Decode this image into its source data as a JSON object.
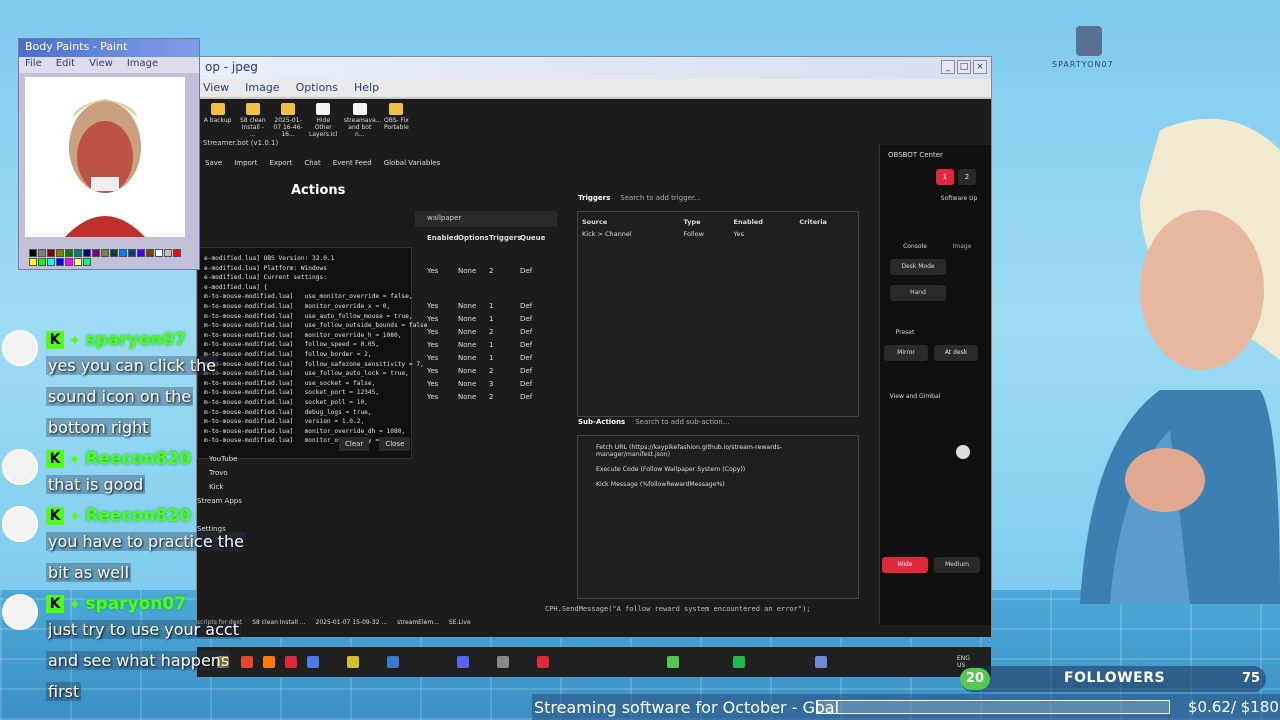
{
  "main_window": {
    "title": "op - jpeg",
    "menu": [
      "View",
      "Image",
      "Options",
      "Help"
    ],
    "controls": [
      "_",
      "□",
      "×"
    ],
    "desktop_icons": [
      {
        "label": "A backup",
        "kind": "folder"
      },
      {
        "label": "S8 clean Install - ...",
        "kind": "folder"
      },
      {
        "label": "2025-01-07 16-46-16...",
        "kind": "folder"
      },
      {
        "label": "Hide Other Layers.icl",
        "kind": "doc"
      },
      {
        "label": "streamava... and bot n...",
        "kind": "doc"
      },
      {
        "label": "OBS- Fix Portable",
        "kind": "folder"
      }
    ],
    "app_title": "Streamer.bot (v1.0.1)",
    "toolbar": [
      "Save",
      "Import",
      "Export",
      "Chat",
      "Event Feed",
      "Global Variables"
    ],
    "page_title": "Actions",
    "search_value": "wallpaper",
    "actions_table": {
      "headers": [
        "Enabled",
        "Options",
        "Triggers",
        "Queue"
      ],
      "rows": [
        [
          "Yes",
          "None",
          "2",
          "Def"
        ],
        [
          "Yes",
          "None",
          "1",
          "Def"
        ],
        [
          "Yes",
          "None",
          "1",
          "Def"
        ],
        [
          "Yes",
          "None",
          "2",
          "Def"
        ],
        [
          "Yes",
          "None",
          "1",
          "Def"
        ],
        [
          "Yes",
          "None",
          "1",
          "Def"
        ],
        [
          "Yes",
          "None",
          "2",
          "Def"
        ],
        [
          "Yes",
          "None",
          "3",
          "Def"
        ],
        [
          "Yes",
          "None",
          "2",
          "Def"
        ]
      ]
    },
    "console_lines": [
      "e-modified.lua] OBS Version: 32.0.1",
      "e-modified.lua] Platform: Windows",
      "e-modified.lua] Current settings:",
      "e-modified.lua] {",
      "m-to-mouse-modified.lua]   use_monitor_override = false,",
      "m-to-mouse-modified.lua]   monitor_override_x = 0,",
      "m-to-mouse-modified.lua]   use_auto_follow_mouse = true,",
      "m-to-mouse-modified.lua]   use_follow_outside_bounds = false",
      "m-to-mouse-modified.lua]   monitor_override_h = 1080,",
      "m-to-mouse-modified.lua]   follow_speed = 0.05,",
      "m-to-mouse-modified.lua]   follow_border = 2,",
      "m-to-mouse-modified.lua]   follow_safezone_sensitivity = 7,",
      "m-to-mouse-modified.lua]   use_follow_auto_lock = true,",
      "m-to-mouse-modified.lua]   use_socket = false,",
      "m-to-mouse-modified.lua]   socket_port = 12345,",
      "m-to-mouse-modified.lua]   socket_poll = 10,",
      "m-to-mouse-modified.lua]   debug_logs = true,",
      "m-to-mouse-modified.lua]   version = 1.0.2,",
      "m-to-mouse-modified.lua]   monitor_override_dh = 1080,",
      "m-to-mouse-modified.lua]   monitor_override_y = 0,"
    ],
    "console_buttons": {
      "clear": "Clear",
      "close": "Close"
    },
    "left_nav": [
      "YouTube",
      "Trovo",
      "Kick",
      "Stream Apps",
      "Settings"
    ],
    "triggers": {
      "title": "Triggers",
      "search_placeholder": "Search to add trigger...",
      "headers": [
        "Source",
        "Type",
        "Enabled",
        "Criteria"
      ],
      "rows": [
        [
          "Kick > Channel",
          "Follow",
          "Yes",
          ""
        ]
      ]
    },
    "sub_actions": {
      "title": "Sub-Actions",
      "search_placeholder": "Search to add sub-action...",
      "items": [
        "Fetch URL (https://kaypikefashion.github.io/stream-rewards-manager/manifest.json)",
        "Execute Code (Follow Wallpaper System (Copy))",
        "Kick Message (%followRewardMessage%)"
      ]
    },
    "code_line": "CPH.SendMessage(\"A follow reward system encountered an error\");",
    "bottom_icons": [
      {
        "label": "scripts for dext"
      },
      {
        "label": "S8 clean Install ..."
      },
      {
        "label": "2025-01-07 15-09-32 ..."
      },
      {
        "label": "streamElem..."
      },
      {
        "label": "SE.Live"
      }
    ],
    "obs_panel": {
      "title": "OBSBOT Center",
      "software_update": "Software Up",
      "tabs": [
        "Console",
        "Image"
      ],
      "mode": "Desk Mode",
      "hand": "Hand",
      "preset": "Preset",
      "mirror": "Mirror",
      "at_desk": "At desk",
      "view_gimbal": "View and Gimbal",
      "wide": "Wide",
      "medium": "Medium"
    }
  },
  "paint": {
    "title": "Body Paints - Paint",
    "menu": [
      "File",
      "Edit",
      "View",
      "Image"
    ],
    "palette": [
      "#000000",
      "#808080",
      "#800000",
      "#808000",
      "#008000",
      "#008080",
      "#000080",
      "#800080",
      "#808040",
      "#004040",
      "#0080ff",
      "#004080",
      "#4000ff",
      "#804000",
      "#ffffff",
      "#c0c0c0",
      "#ff0000",
      "#ffff00",
      "#00ff00",
      "#00ffff",
      "#0000ff",
      "#ff00ff",
      "#ffff80",
      "#00ff80"
    ]
  },
  "chat": [
    {
      "user": "sparyon07",
      "lines": [
        "yes you can click the",
        "sound icon on the",
        "bottom right"
      ]
    },
    {
      "user": "Reecon820",
      "lines": [
        "that is good"
      ]
    },
    {
      "user": "Reecon820",
      "lines": [
        "you have to practice the",
        "bit as well"
      ]
    },
    {
      "user": "sparyon07",
      "lines": [
        "just try to use your acct",
        "and see what happens",
        "first"
      ]
    }
  ],
  "ticker": {
    "text": "Streaming software for October - Goal",
    "amount": "$0.62/ $180",
    "progress": 0.003
  },
  "followers": {
    "current": "20",
    "label": "FOLLOWERS",
    "goal": "75"
  },
  "streamer_name": "SPARTYON07",
  "colors": {
    "kick_green": "#53fc18",
    "accent_red": "#e0283c"
  }
}
